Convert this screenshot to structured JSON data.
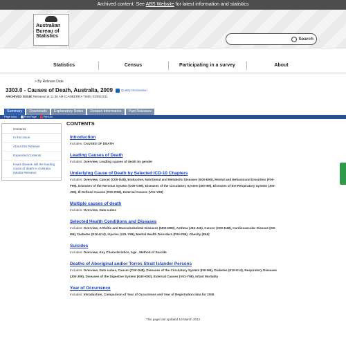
{
  "archive_bar": {
    "text": "Archived content. See ",
    "link": "ABS Website",
    "suffix": " for latest information and statistics"
  },
  "logo": {
    "line1": "Australian",
    "line2": "Bureau of",
    "line3": "Statistics"
  },
  "search": {
    "placeholder": "",
    "button_label": "Search"
  },
  "nav": [
    "Statistics",
    "Census",
    "Participating in a survey",
    "About"
  ],
  "breadcrumb": "> By Release Date",
  "page": {
    "title": "3303.0 - Causes of Death, Australia, 2009",
    "quality_link": "Quality Declaration",
    "release_label": "ARCHIVED ISSUE",
    "release_text": " Released at 11:30 AM (CANBERRA TIME) 03/05/2011"
  },
  "tabs": [
    "Summary",
    "Downloads",
    "Explanatory Notes",
    "Related Information",
    "Past Releases"
  ],
  "tools": {
    "label": "Page tools:",
    "print": "Print Page",
    "print_all": "Print All"
  },
  "sidebar": {
    "heading": "Contents",
    "items": [
      "In this issue",
      "About this Release",
      "Expanded Contents",
      "Heart disease still the leading cause of death in Australia (Media Release)"
    ]
  },
  "main": {
    "heading": "CONTENTS",
    "sections": [
      {
        "title": "Introduction",
        "prefix": "Includes: ",
        "desc": "CAUSES OF DEATH"
      },
      {
        "title": "Leading Causes of Death",
        "prefix": "Includes: ",
        "desc": "Overview, Leading causes of death by gender"
      },
      {
        "title": "Underlying Cause of Death by Selected ICD-10 Chapters",
        "prefix": "Includes: ",
        "desc": "Overview, Cancer (C00-D48), Endocrine, Nutritional and Metabolic Diseases (E00-E90), Mental and Behavioural Disorders (F00-F99), Diseases of the Nervous System (G00-G99), Diseases of the Circulatory System (I00-I99), Diseases of the Respiratory System (J00-J99), Ill Defined Causes (R00-R99), External Causes (V01-Y98)"
      },
      {
        "title": "Multiple causes of death",
        "prefix": "Includes: ",
        "desc": "Overview, Data cubes"
      },
      {
        "title": "Selected Health Conditions and Diseases",
        "prefix": "Includes: ",
        "desc": "Overview, Arthritis and Musculoskeletal Diseases (M00-M99), Asthma (J45-J46), Cancer (C00-D48), Cardiovascular Disease (I00-I99), Diabetes (E10-E14), Injuries (V01-Y98), Mental Health Disorders (F00-F99), Obesity (E66)"
      },
      {
        "title": "Suicides",
        "prefix": "Includes: ",
        "desc": "Overview, Key Characteristics, Age , Method of Suicide"
      },
      {
        "title": "Deaths of Aboriginal and/or Torres Strait Islander Persons",
        "prefix": "Includes: ",
        "desc": "Overview, Data cubes, Cancer (C00-D48), Diseases of the Circulatory System (I00-I99), Diabetes (E10-E14), Respiratory Diseases (J00-J99), Diseases of the Digestive System (K00-K93), External Causes (V01-Y98), Infant Mortality"
      },
      {
        "title": "Year of Occurrence",
        "prefix": "Includes: ",
        "desc": "Introduction, Comparison of Year of Occurrence and Year of Registration data for 2008"
      }
    ]
  },
  "footer": "This page last updated 19 March 2012"
}
